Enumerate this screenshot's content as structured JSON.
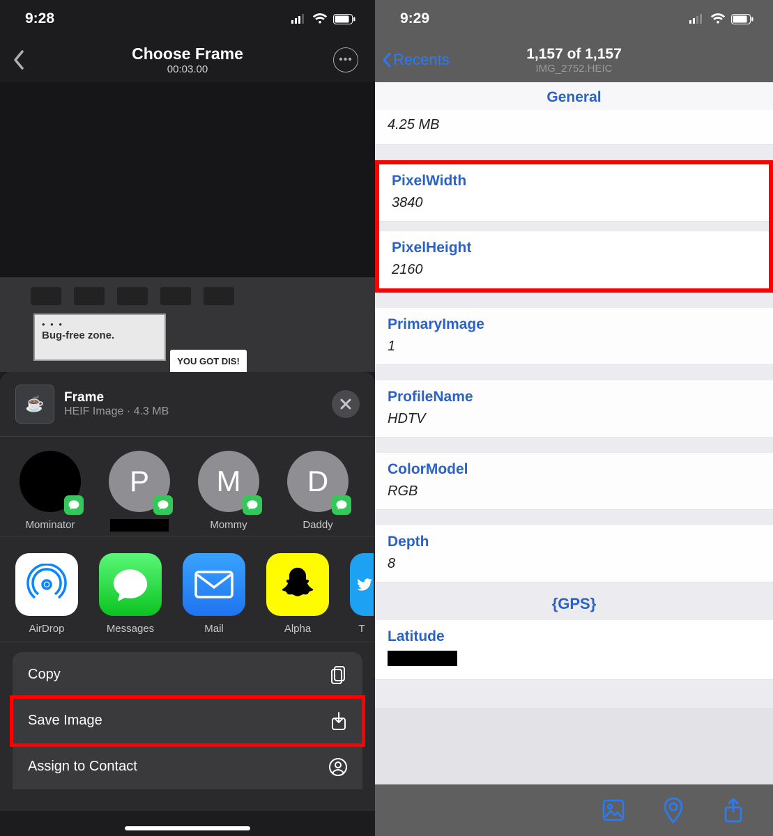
{
  "left": {
    "status": {
      "time": "9:28"
    },
    "nav": {
      "title": "Choose Frame",
      "subtitle": "00:03.00"
    },
    "frame_preview": {
      "sticker1_text": "Bug-free zone.",
      "sticker2_text": "YOU GOT DIS!"
    },
    "sheet": {
      "title": "Frame",
      "subtitle": "HEIF Image · 4.3 MB",
      "contacts": [
        {
          "initial": "",
          "name": "Mominator",
          "dark": true
        },
        {
          "initial": "P",
          "name": ""
        },
        {
          "initial": "M",
          "name": "Mommy"
        },
        {
          "initial": "D",
          "name": "Daddy"
        }
      ],
      "apps": [
        {
          "label": "AirDrop"
        },
        {
          "label": "Messages"
        },
        {
          "label": "Mail"
        },
        {
          "label": "Alpha"
        },
        {
          "label": "T"
        }
      ],
      "actions": [
        {
          "label": "Copy",
          "highlight": false
        },
        {
          "label": "Save Image",
          "highlight": true
        },
        {
          "label": "Assign to Contact",
          "highlight": false
        }
      ]
    }
  },
  "right": {
    "status": {
      "time": "9:29"
    },
    "nav": {
      "back": "Recents",
      "title": "1,157 of 1,157",
      "subtitle": "IMG_2752.HEIC"
    },
    "groups": {
      "general": {
        "header": "General",
        "size": "4.25 MB",
        "rows": [
          {
            "label": "PixelWidth",
            "value": "3840",
            "hl": true
          },
          {
            "label": "PixelHeight",
            "value": "2160",
            "hl": true
          },
          {
            "label": "PrimaryImage",
            "value": "1"
          },
          {
            "label": "ProfileName",
            "value": "HDTV"
          },
          {
            "label": "ColorModel",
            "value": "RGB"
          },
          {
            "label": "Depth",
            "value": "8"
          }
        ]
      },
      "gps": {
        "header": "{GPS}",
        "rows": [
          {
            "label": "Latitude",
            "value": "",
            "redact": true
          }
        ]
      }
    }
  }
}
